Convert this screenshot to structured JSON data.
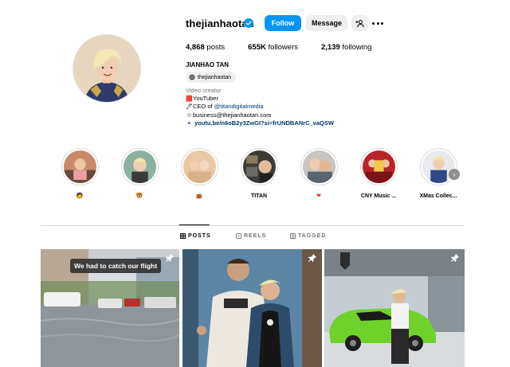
{
  "profile": {
    "username": "thejianhaotan",
    "follow_label": "Follow",
    "message_label": "Message",
    "stats": [
      {
        "value": "4,868",
        "label": "posts"
      },
      {
        "value": "655K",
        "label": "followers"
      },
      {
        "value": "2,139",
        "label": "following"
      }
    ],
    "full_name": "JIANHAO TAN",
    "threads_handle": "thejianhaotan",
    "bio": {
      "category": "Video creator",
      "line1_emoji": "🟥",
      "line1_text": "YouTuber",
      "line2_emoji": "🖊",
      "line2_text": "CEO of ",
      "line2_mention": "@titandigitalmedia",
      "line3_emoji": "✉",
      "line3_text": "business@thejianhaotan.com",
      "link_text": "youtu.be/n6oB2y3ZwGI?si=frUNDBANrC_vaQSW"
    }
  },
  "highlights": [
    {
      "label": "🧑"
    },
    {
      "label": "🐯"
    },
    {
      "label": "👜"
    },
    {
      "label": "TITAN"
    },
    {
      "label": "❤"
    },
    {
      "label": "CNY Music ..."
    },
    {
      "label": "XMas Collec..."
    }
  ],
  "tabs": [
    {
      "label": "POSTS",
      "active": true
    },
    {
      "label": "REELS",
      "active": false
    },
    {
      "label": "TAGGED",
      "active": false
    }
  ],
  "posts": [
    {
      "caption": "We had to catch our flight",
      "pinned": true
    },
    {
      "caption": "",
      "pinned": true
    },
    {
      "caption": "",
      "pinned": true
    }
  ],
  "colors": {
    "accent": "#0095f6",
    "link": "#00376b",
    "muted": "#737373"
  }
}
